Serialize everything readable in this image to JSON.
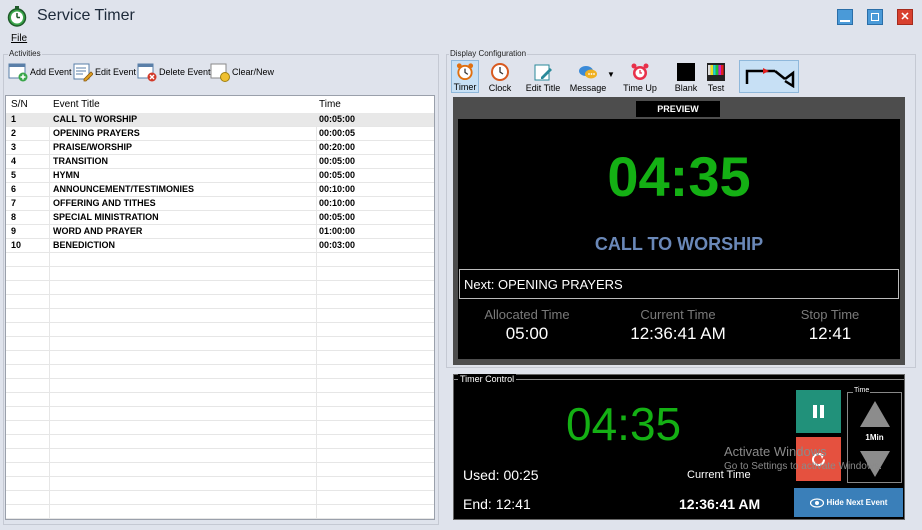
{
  "app": {
    "title": "Service Timer"
  },
  "menu": {
    "file": "File"
  },
  "activities": {
    "label": "Activities",
    "toolbar": {
      "add": "Add Event",
      "edit": "Edit Event",
      "delete": "Delete Event",
      "clear": "Clear/New"
    },
    "columns": {
      "sn": "S/N",
      "title": "Event Title",
      "time": "Time"
    },
    "rows": [
      {
        "sn": "1",
        "title": "CALL TO WORSHIP",
        "time": "00:05:00"
      },
      {
        "sn": "2",
        "title": "OPENING PRAYERS",
        "time": "00:00:05"
      },
      {
        "sn": "3",
        "title": "PRAISE/WORSHIP",
        "time": "00:20:00"
      },
      {
        "sn": "4",
        "title": "TRANSITION",
        "time": "00:05:00"
      },
      {
        "sn": "5",
        "title": "HYMN",
        "time": "00:05:00"
      },
      {
        "sn": "6",
        "title": "ANNOUNCEMENT/TESTIMONIES",
        "time": "00:10:00"
      },
      {
        "sn": "7",
        "title": "OFFERING AND TITHES",
        "time": "00:10:00"
      },
      {
        "sn": "8",
        "title": "SPECIAL MINISTRATION",
        "time": "00:05:00"
      },
      {
        "sn": "9",
        "title": "WORD AND PRAYER",
        "time": "01:00:00"
      },
      {
        "sn": "10",
        "title": "BENEDICTION",
        "time": "00:03:00"
      }
    ]
  },
  "display": {
    "label": "Display Configuration",
    "tools": {
      "timer": "Timer",
      "clock": "Clock",
      "edit_title": "Edit Title",
      "message": "Message",
      "time_up": "Time Up",
      "blank": "Blank",
      "test": "Test"
    }
  },
  "preview": {
    "tag": "PREVIEW",
    "time": "04:35",
    "title": "CALL TO WORSHIP",
    "next": "Next: OPENING PRAYERS",
    "allocated_label": "Allocated Time",
    "allocated_value": "05:00",
    "current_label": "Current Time",
    "current_value": "12:36:41 AM",
    "stop_label": "Stop Time",
    "stop_value": "12:41"
  },
  "timer_control": {
    "label": "Timer Control",
    "time": "04:35",
    "used": "Used: 00:25",
    "end": "End: 12:41",
    "current_label": "Current Time",
    "current_value": "12:36:41 AM",
    "time_group_label": "Time",
    "step": "1Min",
    "hide_next": "Hide Next Event"
  },
  "watermark": {
    "line1": "Activate Windows",
    "line2": "Go to Settings to activate Windows."
  },
  "colors": {
    "timer_green": "#14b014",
    "title_blue": "#6a88b8",
    "pause_teal": "#21917a",
    "reset_red": "#e5513f",
    "hide_blue": "#3a7fb9"
  }
}
